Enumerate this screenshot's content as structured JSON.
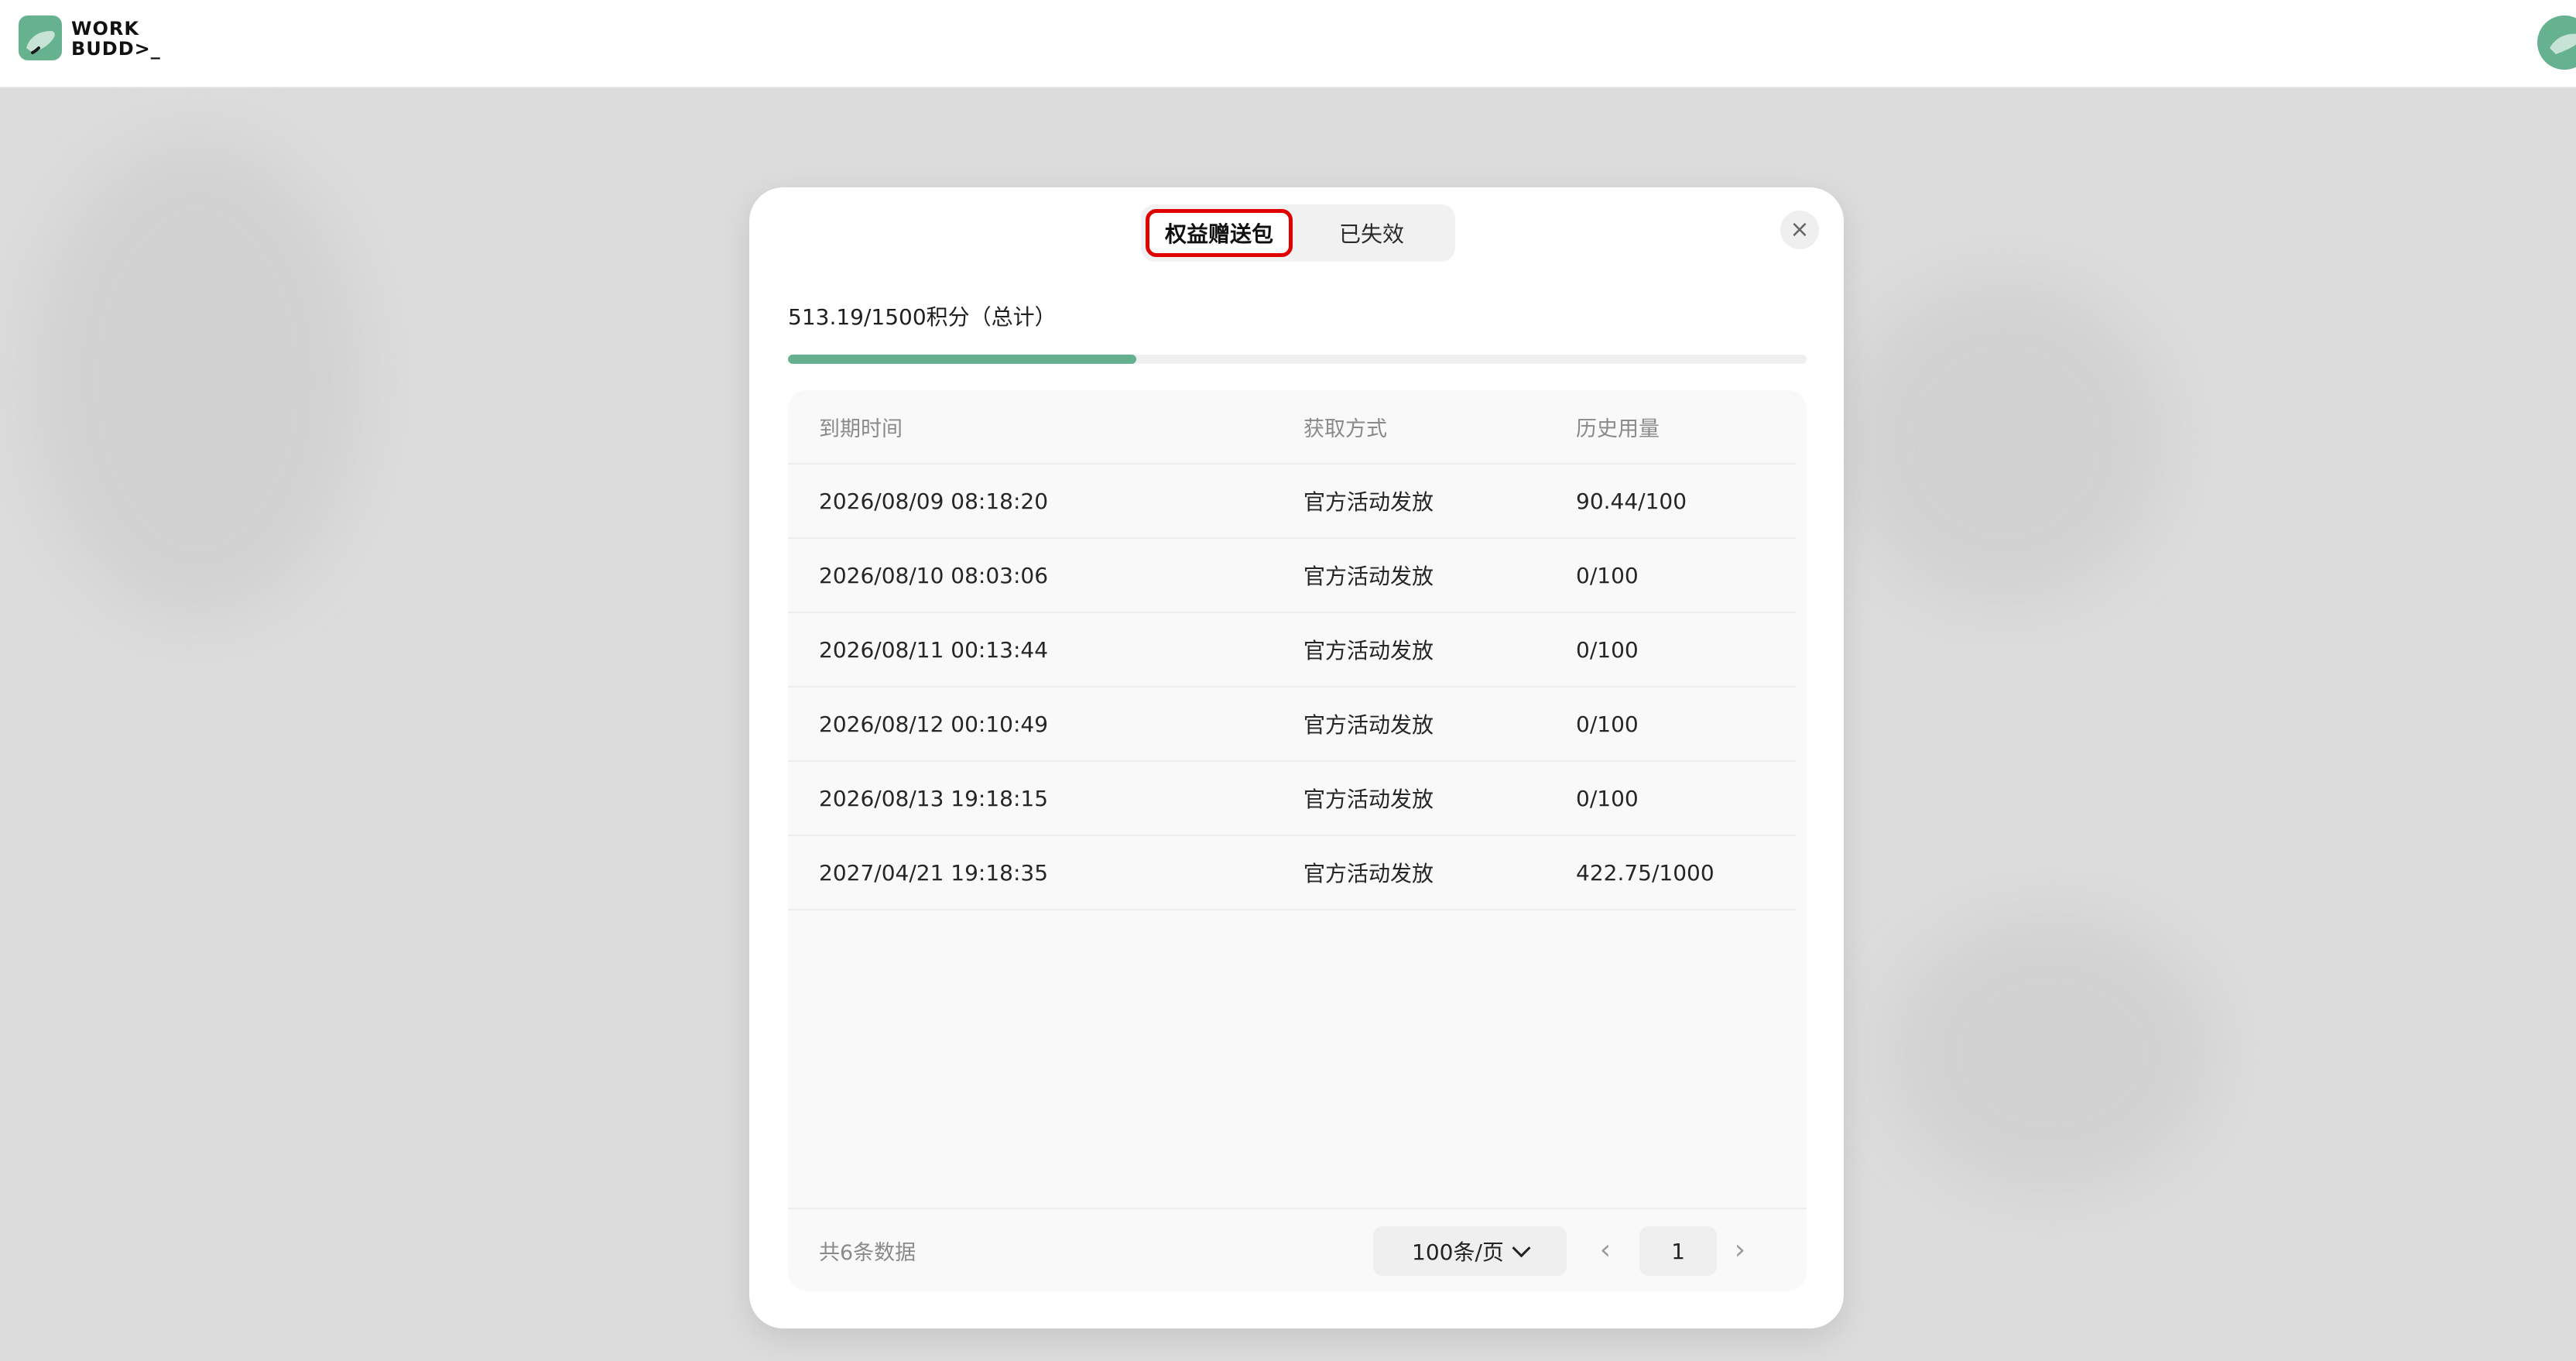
{
  "app": {
    "logo_text": "WORK\nBUDD>_"
  },
  "dialog": {
    "tabs": [
      {
        "label": "权益赠送包",
        "active": true
      },
      {
        "label": "已失效",
        "active": false
      }
    ],
    "close_symbol": "×",
    "summary_text": "513.19/1500积分（总计）",
    "progress_percent": 34.2,
    "table": {
      "headers": [
        "到期时间",
        "获取方式",
        "历史用量"
      ],
      "rows": [
        [
          "2026/08/09 08:18:20",
          "官方活动发放",
          "90.44/100"
        ],
        [
          "2026/08/10 08:03:06",
          "官方活动发放",
          "0/100"
        ],
        [
          "2026/08/11 00:13:44",
          "官方活动发放",
          "0/100"
        ],
        [
          "2026/08/12 00:10:49",
          "官方活动发放",
          "0/100"
        ],
        [
          "2026/08/13 19:18:15",
          "官方活动发放",
          "0/100"
        ],
        [
          "2027/04/21 19:18:35",
          "官方活动发放",
          "422.75/1000"
        ]
      ]
    },
    "footer": {
      "total_text": "共6条数据",
      "page_size_label": "100条/页",
      "current_page": "1",
      "prev_symbol": "‹",
      "next_symbol": "›"
    }
  },
  "colors": {
    "accent_green": "#64b08f",
    "highlight_red": "#e00000"
  },
  "icons": {
    "close": "close-icon",
    "chevron_down": "chevron-down-icon",
    "prev": "chevron-left-icon",
    "next": "chevron-right-icon"
  }
}
